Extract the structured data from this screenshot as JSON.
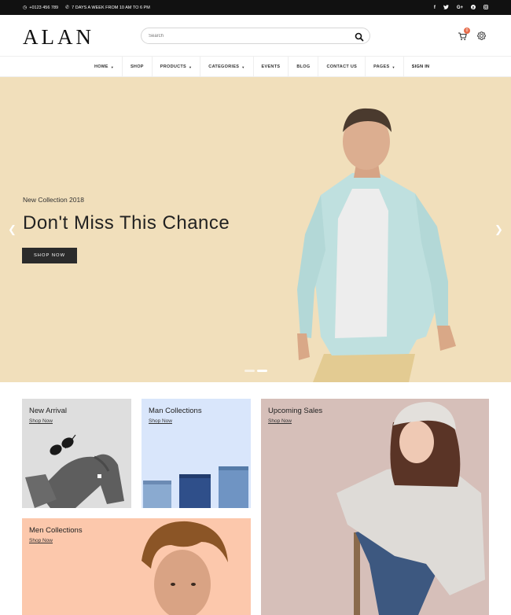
{
  "topbar": {
    "phone": "+0123 456 789",
    "hours": "7 DAYS A WEEK FROM 10 AM TO 6 PM",
    "social": [
      "f",
      "t",
      "G+",
      "p",
      "ig"
    ]
  },
  "header": {
    "logo": "ALAN",
    "search_placeholder": "Search",
    "cart_count": "0"
  },
  "nav": {
    "items": [
      "HOME",
      "SHOP",
      "PRODUCTS",
      "CATEGORIES",
      "EVENTS",
      "BLOG",
      "CONTACT US",
      "PAGES",
      "SIGN IN"
    ]
  },
  "hero": {
    "eyebrow": "New Collection 2018",
    "headline": "Don't Miss This Chance",
    "cta": "SHOP NOW"
  },
  "banners": {
    "new_arrival": {
      "title": "New Arrival",
      "link": "Shop Now"
    },
    "man_collections": {
      "title": "Man Collections",
      "link": "Shop Now"
    },
    "upcoming_sales": {
      "title": "Upcoming Sales",
      "link": "Shop Now"
    },
    "men_collections": {
      "title": "Men Collections",
      "link": "Shop Now"
    }
  },
  "colors": {
    "hero_bg": "#f1dfbb",
    "accent_badge": "#e66b4a",
    "banner_new_arrival": "#dedede",
    "banner_man": "#d9e6fb",
    "banner_upcoming": "#d6bfb9",
    "banner_men": "#fcc8ac"
  }
}
